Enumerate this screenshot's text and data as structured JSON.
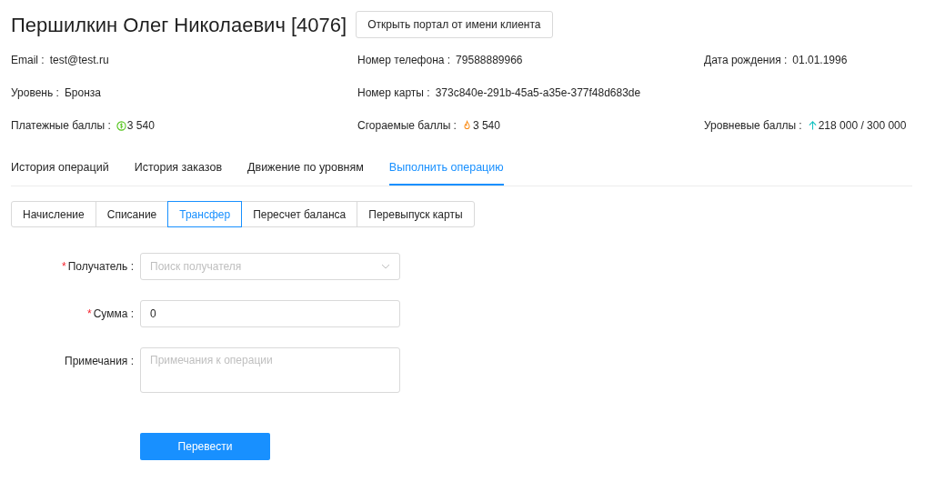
{
  "title": "Першилкин Олег Николаевич [4076]",
  "portal_button": "Открыть портал от имени клиента",
  "info": [
    {
      "label": "Email :",
      "value": "test@test.ru",
      "kind": "text"
    },
    {
      "label": "Номер телефона :",
      "value": "79588889966",
      "kind": "text"
    },
    {
      "label": "Дата рождения :",
      "value": "01.01.1996",
      "kind": "text"
    },
    {
      "label": "Уровень :",
      "value": "Бронза",
      "kind": "text"
    },
    {
      "label": "Номер карты :",
      "value": "373c840e-291b-45a5-a35e-377f48d683de",
      "kind": "text"
    },
    {
      "kind": "empty"
    },
    {
      "label": "Платежные баллы :",
      "value": "3 540",
      "kind": "payment"
    },
    {
      "label": "Сгораемые баллы :",
      "value": "3 540",
      "kind": "burning"
    },
    {
      "label": "Уровневые баллы :",
      "value": "218 000 / 300 000",
      "kind": "level"
    }
  ],
  "tabs": [
    {
      "label": "История операций",
      "selected": false
    },
    {
      "label": "История заказов",
      "selected": false
    },
    {
      "label": "Движение по уровням",
      "selected": false
    },
    {
      "label": "Выполнить операцию",
      "selected": true
    }
  ],
  "operations": [
    {
      "label": "Начисление",
      "selected": false
    },
    {
      "label": "Списание",
      "selected": false
    },
    {
      "label": "Трансфер",
      "selected": true
    },
    {
      "label": "Пересчет баланса",
      "selected": false
    },
    {
      "label": "Перевыпуск карты",
      "selected": false
    }
  ],
  "form": [
    {
      "kind": "select",
      "required_mark": "*",
      "label": "Получатель :",
      "placeholder": "Поиск получателя"
    },
    {
      "kind": "input",
      "required_mark": "*",
      "label": "Сумма :",
      "value": "0"
    },
    {
      "kind": "textarea",
      "label": "Примечания :",
      "placeholder": "Примечания к операции"
    }
  ],
  "submit_button": "Перевести"
}
